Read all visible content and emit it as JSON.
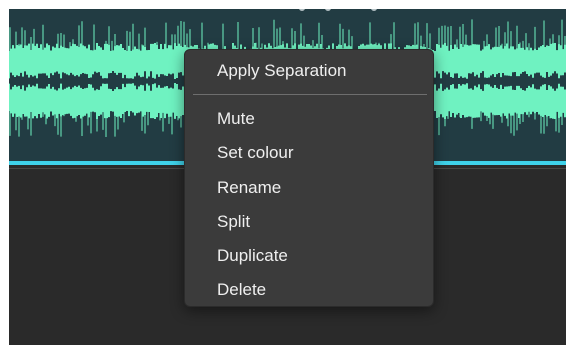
{
  "context_menu": {
    "items": [
      {
        "label": "Apply Separation"
      },
      {
        "label": "Mute"
      },
      {
        "label": "Set colour"
      },
      {
        "label": "Rename"
      },
      {
        "label": "Split"
      },
      {
        "label": "Duplicate"
      },
      {
        "label": "Delete"
      }
    ]
  },
  "colors": {
    "clip_background": "#223c43",
    "waveform": "#6ff2c1",
    "playhead_line": "#3fd2ea",
    "track_background": "#2a2a2a",
    "menu_background": "#3b3b3b",
    "menu_text": "#efefef"
  }
}
